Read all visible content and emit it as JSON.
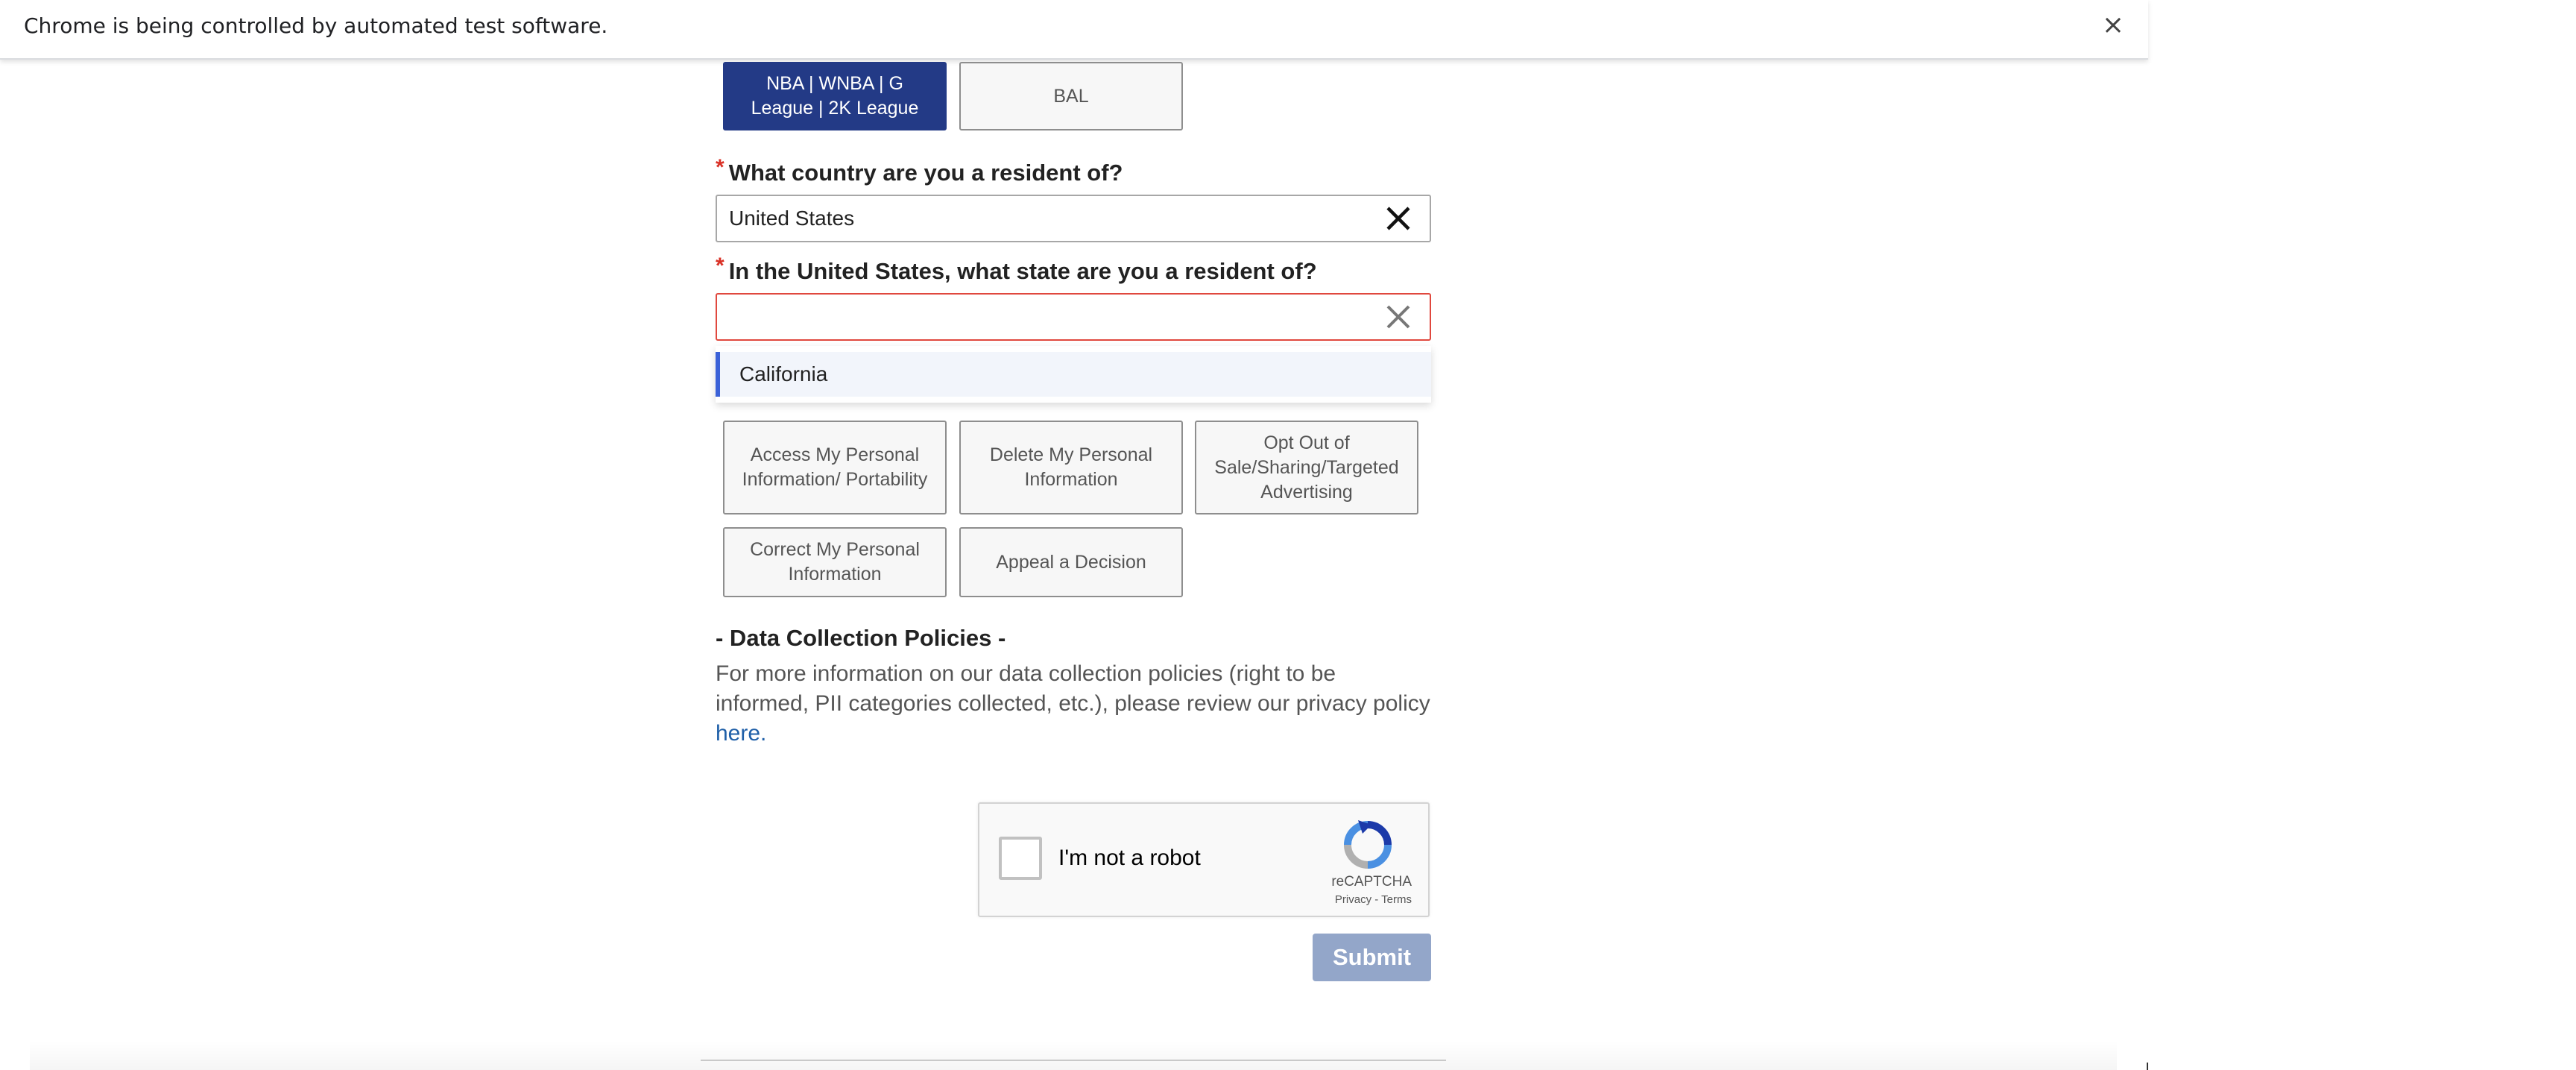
{
  "infobar": {
    "message": "Chrome is being controlled by automated test software.",
    "close_symbol": "×"
  },
  "league_options": [
    {
      "label": "NBA | WNBA | G League | 2K League",
      "selected": true
    },
    {
      "label": "BAL",
      "selected": false
    }
  ],
  "country_question": {
    "required_mark": "*",
    "label": "What country are you a resident of?",
    "value": "United States"
  },
  "state_question": {
    "required_mark": "*",
    "label": "In the United States, what state are you a resident of?",
    "value": "",
    "dropdown_options": [
      "California"
    ]
  },
  "request_options": [
    {
      "label": "Access My Personal Information/ Portability"
    },
    {
      "label": "Delete My Personal Information"
    },
    {
      "label": "Opt Out of Sale/Sharing/Targeted Advertising"
    },
    {
      "label": "Correct My Personal Information"
    },
    {
      "label": "Appeal a Decision"
    }
  ],
  "data_policies": {
    "title": "- Data Collection Policies -",
    "body": "For more information on our data collection policies (right to be informed, PII categories collected, etc.), please review our privacy policy",
    "link_text": "here."
  },
  "recaptcha": {
    "label": "I'm not a robot",
    "brand": "reCAPTCHA",
    "links": "Privacy - Terms"
  },
  "submit_label": "Submit",
  "colors": {
    "selected_button": "#233a86",
    "submit_disabled": "#93a6c9",
    "error_border": "#e0483e",
    "link": "#1f5fa8",
    "dropdown_accent": "#3b62d8"
  }
}
